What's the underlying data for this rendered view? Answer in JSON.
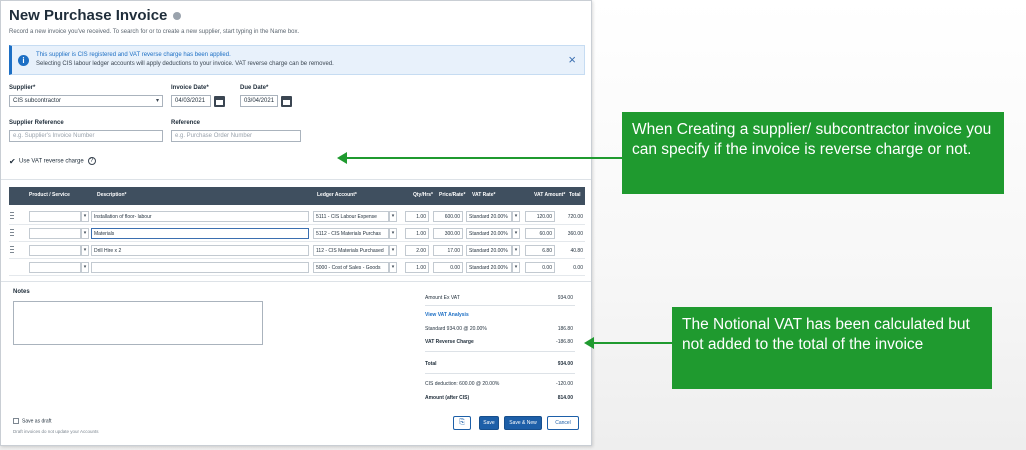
{
  "header": {
    "title": "New Purchase Invoice",
    "subtitle": "Record a new invoice you've received. To search for or to create a new supplier, start typing in the Name box."
  },
  "banner": {
    "line1": "This supplier is CIS registered and VAT reverse charge has been applied.",
    "line2": "Selecting CIS labour ledger accounts will apply deductions to your invoice. VAT reverse charge can be removed.",
    "close": "×"
  },
  "form": {
    "supplier_label": "Supplier*",
    "supplier_value": "CIS subcontractor",
    "invoice_date_label": "Invoice Date*",
    "invoice_date_value": "04/03/2021",
    "due_date_label": "Due Date*",
    "due_date_value": "03/04/2021",
    "supplier_ref_label": "Supplier Reference",
    "supplier_ref_placeholder": "e.g. Supplier's Invoice Number",
    "reference_label": "Reference",
    "reference_placeholder": "e.g. Purchase Order Number",
    "reverse_charge_label": "Use VAT reverse charge",
    "reverse_charge_checked": "✔",
    "question_mark": "?"
  },
  "table": {
    "headers": {
      "product": "Product / Service",
      "description": "Description*",
      "ledger": "Ledger Account*",
      "qty": "Qty/Hrs*",
      "price": "Price/Rate*",
      "vat_rate": "VAT Rate*",
      "vat_amount": "VAT Amount*",
      "total": "Total"
    },
    "rows": [
      {
        "description": "Installation of floor- labour",
        "ledger": "5111 - CIS Labour Expense",
        "qty": "1.00",
        "price": "600.00",
        "vat_rate": "Standard 20.00%",
        "vat": "120.00",
        "total": "720.00"
      },
      {
        "description": "Materials",
        "ledger": "5112 - CIS Materials Purchas",
        "qty": "1.00",
        "price": "300.00",
        "vat_rate": "Standard 20.00%",
        "vat": "60.00",
        "total": "360.00"
      },
      {
        "description": "Drill Hire x 2",
        "ledger": "112 - CIS Materials Purchased",
        "qty": "2.00",
        "price": "17.00",
        "vat_rate": "Standard 20.00%",
        "vat": "6.80",
        "total": "40.80"
      },
      {
        "description": "",
        "ledger": "5000 - Cost of Sales - Goods",
        "qty": "1.00",
        "price": "0.00",
        "vat_rate": "Standard 20.00%",
        "vat": "0.00",
        "total": "0.00"
      }
    ],
    "caret": "▾"
  },
  "notes": {
    "label": "Notes"
  },
  "summary": {
    "ex_vat_label": "Amount Ex VAT",
    "ex_vat_value": "934.00",
    "vat_analysis_label": "View VAT Analysis",
    "standard_label": "Standard 934.00 @ 20.00%",
    "standard_value": "186.80",
    "reverse_label": "VAT Reverse Charge",
    "reverse_value": "-186.80",
    "total_label": "Total",
    "total_value": "934.00",
    "cis_label": "CIS deduction: 600.00 @ 20.00%",
    "cis_value": "-120.00",
    "after_cis_label": "Amount (after CIS)",
    "after_cis_value": "814.00"
  },
  "footer": {
    "save_draft_label": "Save as draft",
    "draft_note": "Draft invoices do not update your Accounts",
    "attach_icon": "⎘",
    "save_label": "Save",
    "save_new_label": "Save & New",
    "cancel_label": "Cancel"
  },
  "callouts": {
    "top": "When Creating a supplier/ subcontractor invoice you can specify if the invoice is reverse charge or not.",
    "bottom": "The Notional VAT has been calculated but not added to the total of the invoice"
  },
  "colors": {
    "callout_green": "#1f9a2f",
    "table_header": "#3f4f5f",
    "primary_blue": "#1d5fa8"
  }
}
